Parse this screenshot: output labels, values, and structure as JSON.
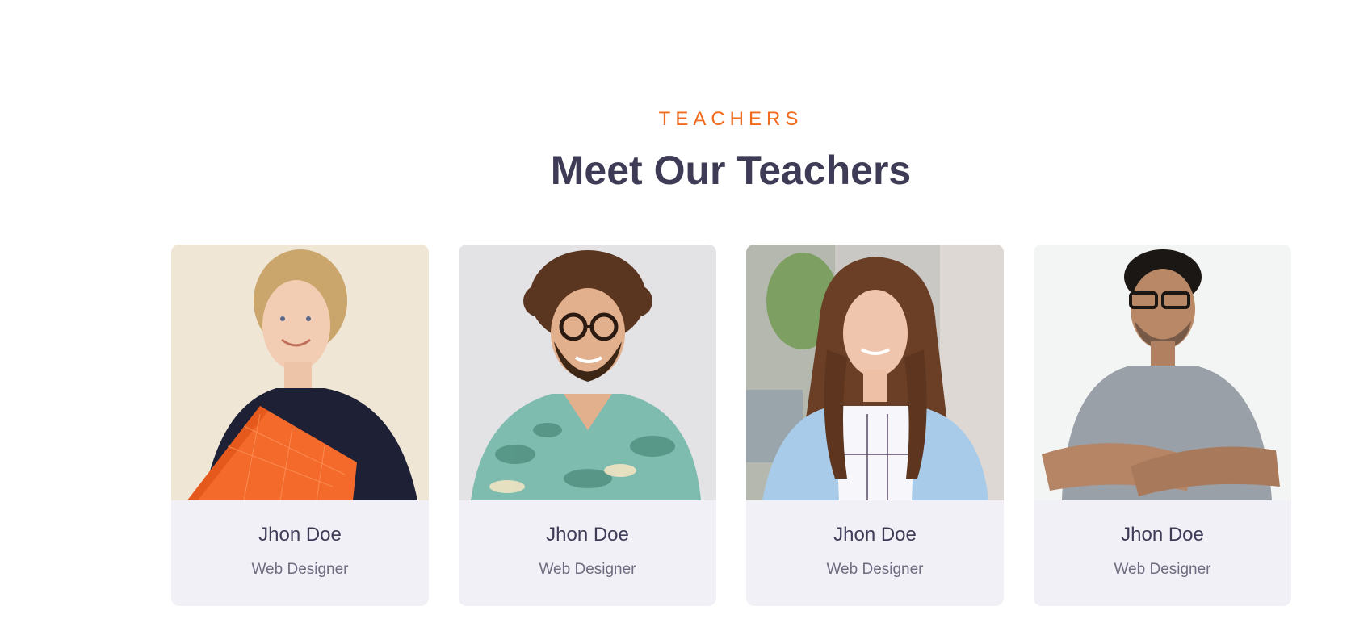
{
  "section": {
    "eyebrow": "TEACHERS",
    "title": "Meet Our Teachers"
  },
  "teachers": [
    {
      "name": "Jhon Doe",
      "role": "Web Designer",
      "photo": "woman-with-orange-folder"
    },
    {
      "name": "Jhon Doe",
      "role": "Web Designer",
      "photo": "curly-haired-man-with-glasses"
    },
    {
      "name": "Jhon Doe",
      "role": "Web Designer",
      "photo": "long-haired-woman-outdoors"
    },
    {
      "name": "Jhon Doe",
      "role": "Web Designer",
      "photo": "man-with-glasses-arms-crossed"
    }
  ],
  "colors": {
    "accent": "#f26a1b",
    "heading": "#3d3b56",
    "card_bg": "#f1f0f6",
    "subtext": "#6e6c80"
  }
}
